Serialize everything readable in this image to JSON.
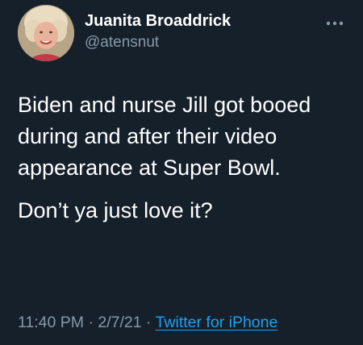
{
  "author": {
    "display_name": "Juanita Broaddrick",
    "handle": "@atensnut"
  },
  "icons": {
    "avatar": "profile-photo",
    "more": "more-horizontal-icon"
  },
  "tweet": {
    "paragraphs": [
      "Biden and nurse Jill got booed during and after their video appearance at Super Bowl.",
      "Don’t ya just love it?"
    ]
  },
  "meta": {
    "time": "11:40 PM",
    "separator": "·",
    "date": "2/7/21",
    "source": "Twitter for iPhone"
  },
  "colors": {
    "background": "#15202b",
    "text": "#ffffff",
    "secondary_text": "#8899a6",
    "link": "#1da1f2"
  }
}
